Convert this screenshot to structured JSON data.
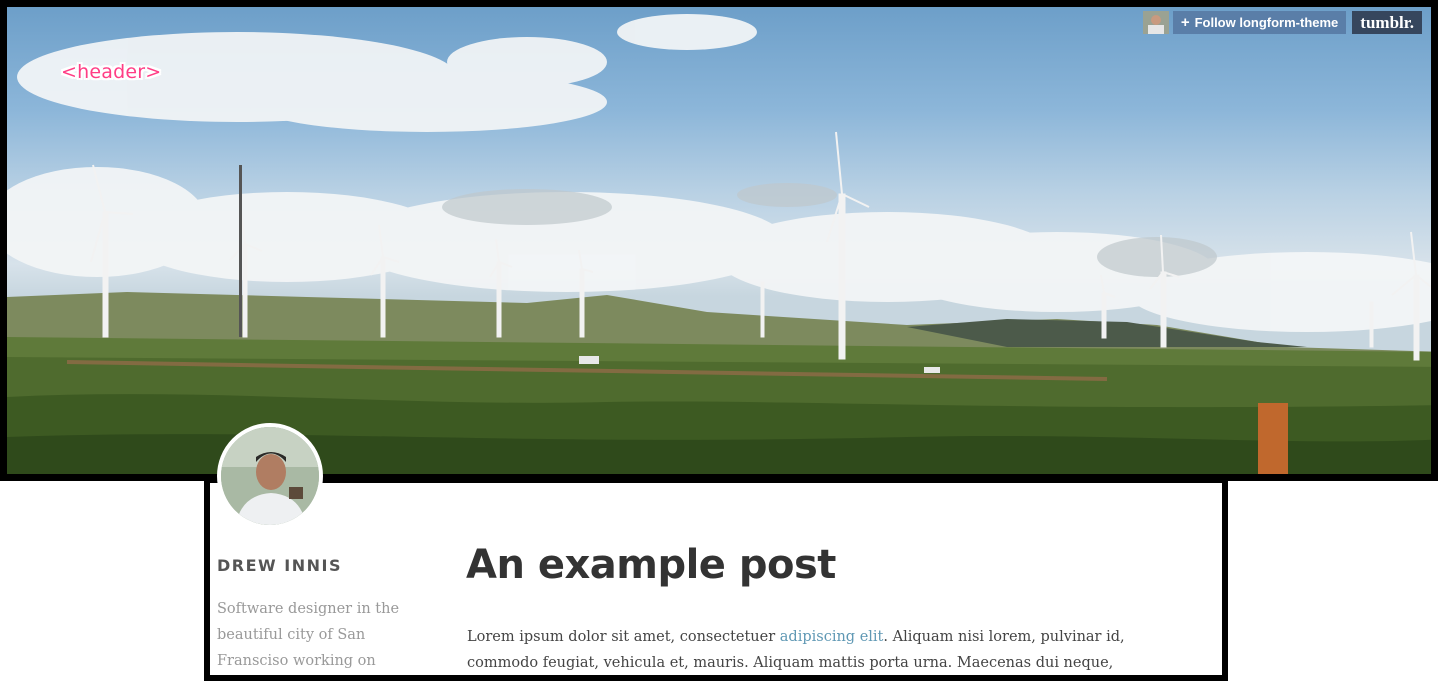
{
  "header": {
    "label": "<header>",
    "follow_plus": "+",
    "follow_label": "Follow longform-theme",
    "tumblr_logo": "tumblr."
  },
  "sidebar": {
    "author_name": "DREW INNIS",
    "author_bio": "Software designer in the beautiful city of San Fransciso working on"
  },
  "post": {
    "title": "An example post",
    "body_before_link": "Lorem ipsum dolor sit amet, consectetuer ",
    "link_text": "adipiscing elit",
    "body_after_link": ". Aliquam nisi lorem, pulvinar id, commodo feugiat, vehicula et, mauris. Aliquam mattis porta urna. Maecenas dui neque,"
  },
  "colors": {
    "header_label": "#ff3d85",
    "follow_bg": "#5a7ea8",
    "tumblr_bg": "#36465d",
    "link": "#5f98b4",
    "title": "#333333",
    "bio": "#999999"
  },
  "icons": {
    "follow": "plus-icon",
    "logo": "tumblr-logo"
  }
}
